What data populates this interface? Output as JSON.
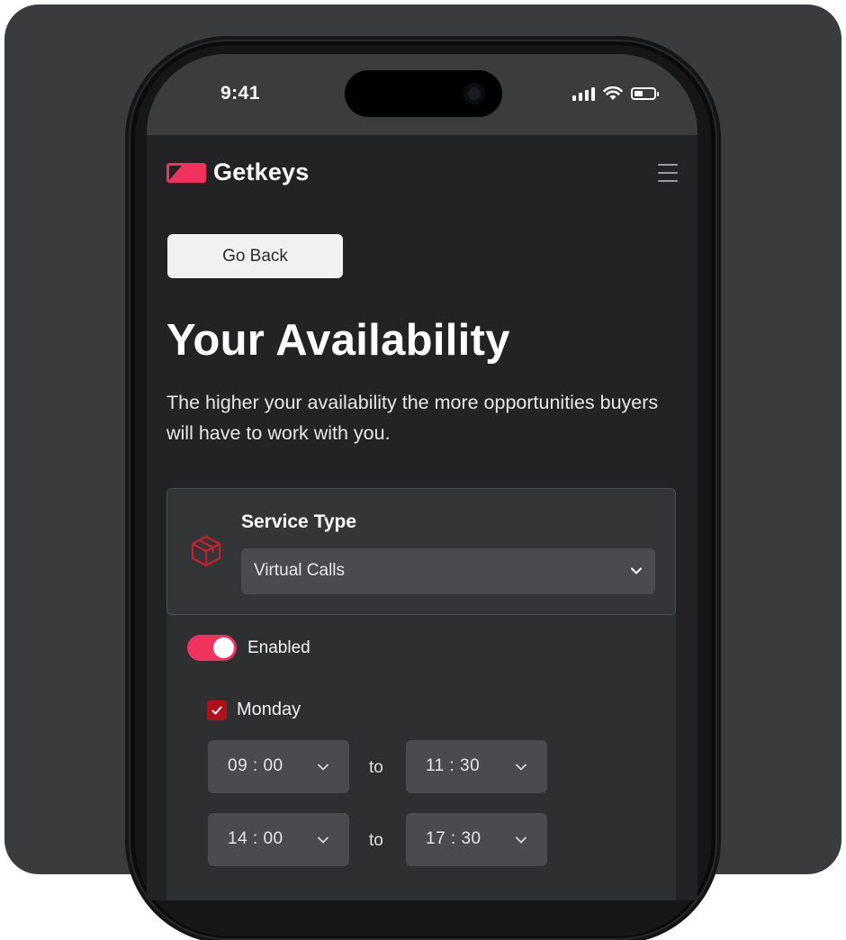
{
  "status_bar": {
    "time": "9:41"
  },
  "header": {
    "brand_name": "Getkeys",
    "brand_color": "#f0325c"
  },
  "page": {
    "back_button_label": "Go Back",
    "title": "Your Availability",
    "subtitle": "The higher your availability the more opportunities buyers will have to work with you."
  },
  "service": {
    "label": "Service Type",
    "selected_option": "Virtual Calls",
    "icon": "box-icon"
  },
  "availability": {
    "enabled_label": "Enabled",
    "enabled": true,
    "day": {
      "name": "Monday",
      "checked": true
    },
    "slots": [
      {
        "from": "09 : 00",
        "separator": "to",
        "until": "11 : 30"
      },
      {
        "from": "14 : 00",
        "separator": "to",
        "until": "17 : 30"
      }
    ]
  },
  "colors": {
    "accent": "#f0325c",
    "checkbox": "#b3101d",
    "background": "#232325"
  }
}
